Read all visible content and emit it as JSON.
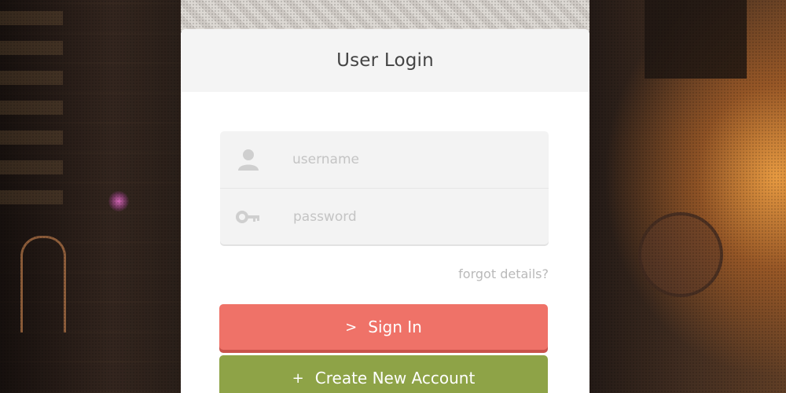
{
  "login": {
    "title": "User Login",
    "username_placeholder": "username",
    "password_placeholder": "password",
    "forgot_link": "forgot details?",
    "signin_glyph": ">",
    "signin_label": "Sign In",
    "create_glyph": "+",
    "create_label": "Create New Account"
  },
  "icons": {
    "username": "user-icon",
    "password": "key-icon"
  },
  "colors": {
    "signin": "#ef7268",
    "create": "#8ea347",
    "header_bg": "#f4f4f4",
    "field_bg": "#f3f3f3"
  }
}
